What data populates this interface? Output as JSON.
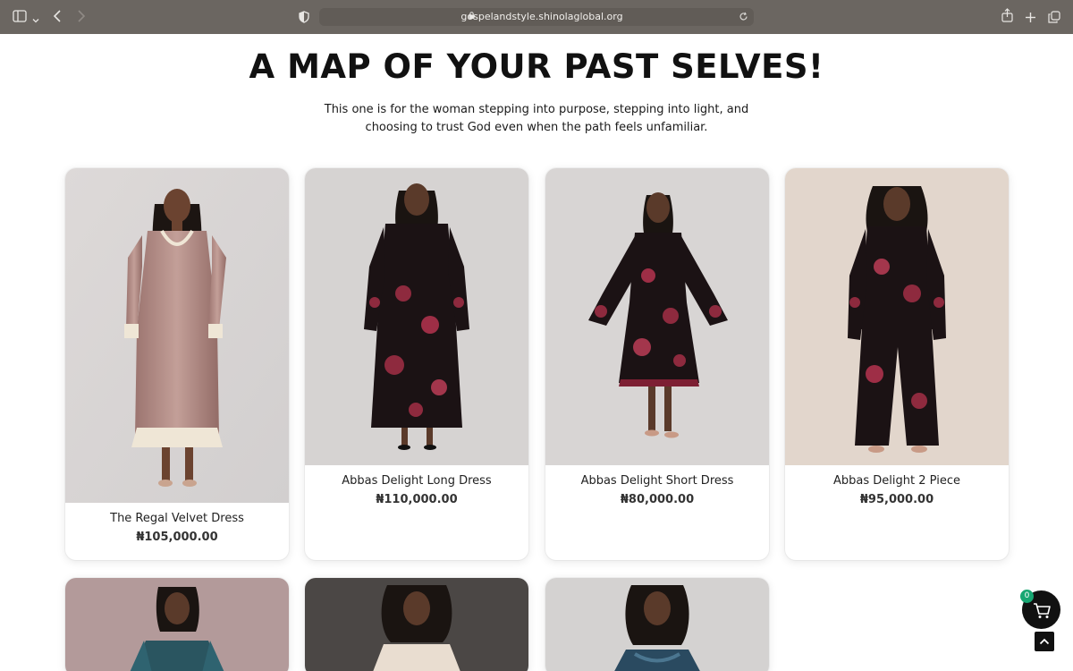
{
  "browser": {
    "url": "gospelandstyle.shinolaglobal.org"
  },
  "page": {
    "title": "A MAP OF YOUR PAST SELVES!",
    "subtitle": "This one is for the woman stepping into purpose, stepping into light, and choosing to trust God even when the path feels unfamiliar."
  },
  "products": [
    {
      "name": "The Regal Velvet Dress",
      "price": "₦105,000.00"
    },
    {
      "name": "Abbas Delight Long Dress",
      "price": "₦110,000.00"
    },
    {
      "name": "Abbas Delight Short Dress",
      "price": "₦80,000.00"
    },
    {
      "name": "Abbas Delight 2 Piece",
      "price": "₦95,000.00"
    }
  ],
  "cart": {
    "count": "0"
  },
  "icons": {
    "sidebar": "sidebar-icon",
    "back": "back-icon",
    "forward": "forward-icon",
    "shield": "shield-icon",
    "lock": "lock-icon",
    "reload": "reload-icon",
    "share": "share-icon",
    "new_tab": "plus-icon",
    "tabs": "tabs-icon",
    "cart": "cart-icon",
    "scroll_top": "chevron-up-icon"
  },
  "colors": {
    "chrome": "#6b6661",
    "badge": "#17a672",
    "button": "#111111"
  }
}
